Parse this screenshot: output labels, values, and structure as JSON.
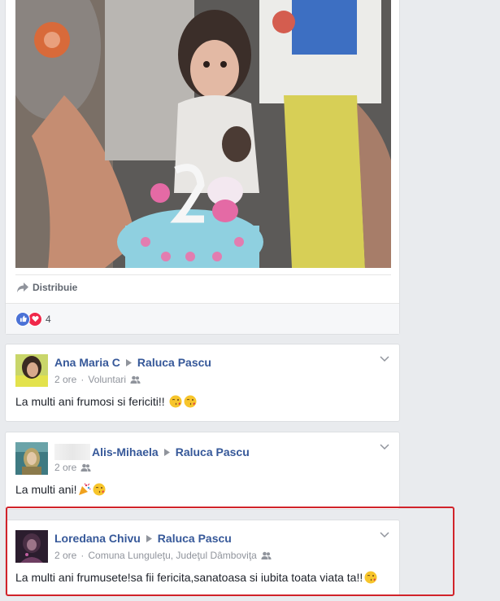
{
  "post": {
    "share_label": "Distribuie",
    "reaction_count": "4",
    "reaction_icons": [
      "like-icon",
      "love-icon"
    ]
  },
  "comments": [
    {
      "author": "Ana Maria C",
      "target": "Raluca Pascu",
      "time": "2 ore",
      "location": "Voluntari",
      "text": "La multi ani frumosi si fericiti!!",
      "emojis": [
        "kiss-emoji",
        "kiss-emoji"
      ]
    },
    {
      "author": "Alis-Mihaela",
      "target": "Raluca Pascu",
      "time": "2 ore",
      "location": "",
      "text": "La multi ani!",
      "emojis": [
        "party-popper-emoji",
        "kiss-emoji"
      ]
    },
    {
      "author": "Loredana Chivu",
      "target": "Raluca Pascu",
      "time": "2 ore",
      "location": "Comuna Lunguleţu, Judeţul Dâmboviţa",
      "text": "La multi ani frumusete!sa fii fericita,sanatoasa si iubita toata viata ta!!",
      "emojis": [
        "kiss-emoji"
      ]
    }
  ],
  "colors": {
    "link": "#365899",
    "meta": "#90949c",
    "highlight": "#d1232a",
    "background": "#e9ebee"
  }
}
